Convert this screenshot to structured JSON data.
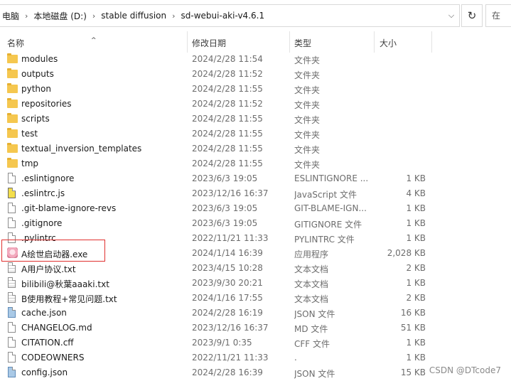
{
  "address": {
    "crumbs": [
      "电脑",
      "本地磁盘 (D:)",
      "stable diffusion",
      "sd-webui-aki-v4.6.1"
    ],
    "search_placeholder": "在"
  },
  "columns": {
    "name": "名称",
    "date": "修改日期",
    "type": "类型",
    "size": "大小"
  },
  "files": [
    {
      "name": "modules",
      "date": "2024/2/28 11:54",
      "type": "文件夹",
      "size": "",
      "icon": "folder-icon"
    },
    {
      "name": "outputs",
      "date": "2024/2/28 11:52",
      "type": "文件夹",
      "size": "",
      "icon": "folder-icon"
    },
    {
      "name": "python",
      "date": "2024/2/28 11:55",
      "type": "文件夹",
      "size": "",
      "icon": "folder-icon"
    },
    {
      "name": "repositories",
      "date": "2024/2/28 11:52",
      "type": "文件夹",
      "size": "",
      "icon": "folder-icon"
    },
    {
      "name": "scripts",
      "date": "2024/2/28 11:55",
      "type": "文件夹",
      "size": "",
      "icon": "folder-icon"
    },
    {
      "name": "test",
      "date": "2024/2/28 11:55",
      "type": "文件夹",
      "size": "",
      "icon": "folder-icon"
    },
    {
      "name": "textual_inversion_templates",
      "date": "2024/2/28 11:55",
      "type": "文件夹",
      "size": "",
      "icon": "folder-icon"
    },
    {
      "name": "tmp",
      "date": "2024/2/28 11:55",
      "type": "文件夹",
      "size": "",
      "icon": "folder-icon"
    },
    {
      "name": ".eslintignore",
      "date": "2023/6/3 19:05",
      "type": "ESLINTIGNORE ...",
      "size": "1 KB",
      "icon": "file-icon"
    },
    {
      "name": ".eslintrc.js",
      "date": "2023/12/16 16:37",
      "type": "JavaScript 文件",
      "size": "4 KB",
      "icon": "js-file-icon"
    },
    {
      "name": ".git-blame-ignore-revs",
      "date": "2023/6/3 19:05",
      "type": "GIT-BLAME-IGN...",
      "size": "1 KB",
      "icon": "file-icon"
    },
    {
      "name": ".gitignore",
      "date": "2023/6/3 19:05",
      "type": "GITIGNORE 文件",
      "size": "1 KB",
      "icon": "file-icon"
    },
    {
      "name": ".pylintrc",
      "date": "2022/11/21 11:33",
      "type": "PYLINTRC 文件",
      "size": "1 KB",
      "icon": "file-icon"
    },
    {
      "name": "A绘世启动器.exe",
      "date": "2024/1/14 16:39",
      "type": "应用程序",
      "size": "2,028 KB",
      "icon": "app-icon"
    },
    {
      "name": "A用户协议.txt",
      "date": "2023/4/15 10:28",
      "type": "文本文档",
      "size": "2 KB",
      "icon": "text-file-icon"
    },
    {
      "name": "bilibili@秋葉aaaki.txt",
      "date": "2023/9/30 20:21",
      "type": "文本文档",
      "size": "1 KB",
      "icon": "text-file-icon"
    },
    {
      "name": "B使用教程+常见问题.txt",
      "date": "2024/1/16 17:55",
      "type": "文本文档",
      "size": "2 KB",
      "icon": "text-file-icon"
    },
    {
      "name": "cache.json",
      "date": "2024/2/28 16:19",
      "type": "JSON 文件",
      "size": "16 KB",
      "icon": "json-file-icon"
    },
    {
      "name": "CHANGELOG.md",
      "date": "2023/12/16 16:37",
      "type": "MD 文件",
      "size": "51 KB",
      "icon": "file-icon"
    },
    {
      "name": "CITATION.cff",
      "date": "2023/9/1 0:35",
      "type": "CFF 文件",
      "size": "1 KB",
      "icon": "file-icon"
    },
    {
      "name": "CODEOWNERS",
      "date": "2022/11/21 11:33",
      "type": ".",
      "size": "1 KB",
      "icon": "file-icon"
    },
    {
      "name": "config.json",
      "date": "2024/2/28 16:39",
      "type": "JSON 文件",
      "size": "15 KB",
      "icon": "json-file-icon"
    }
  ],
  "watermark": "CSDN @DTcode7",
  "colors": {
    "highlight_border": "#e0302f",
    "folder": "#f5c74f"
  }
}
